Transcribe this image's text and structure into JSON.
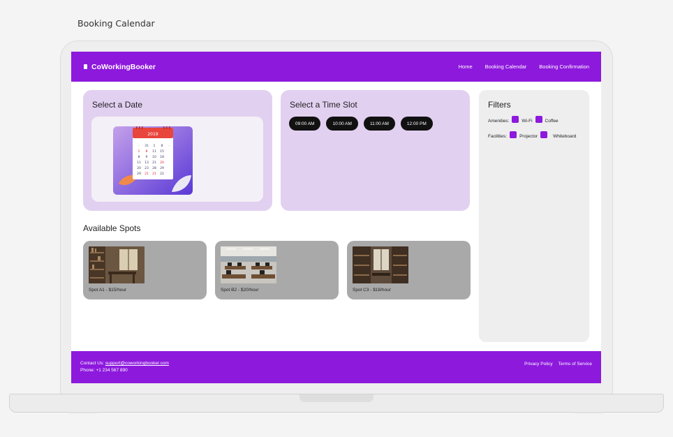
{
  "page_caption": "Booking Calendar",
  "brand": {
    "name": "CoWorkingBooker",
    "icon": "building-icon"
  },
  "nav": {
    "items": [
      "Home",
      "Booking Calendar",
      "Booking Confirmation"
    ]
  },
  "date_card": {
    "title": "Select a Date",
    "illustration": "calendar-icon",
    "calendar_year": "2019"
  },
  "time_card": {
    "title": "Select a Time Slot",
    "slots": [
      "09:00 AM",
      "10:00 AM",
      "11:00 AM",
      "12:00 PM"
    ]
  },
  "filters": {
    "title": "Filters",
    "amenities_label": "Amenities:",
    "amenities": [
      "Wi-Fi",
      "Coffee"
    ],
    "facilities_label": "Facilities:",
    "facilities": [
      "Projector",
      "Whiteboard"
    ]
  },
  "spots_section": {
    "title": "Available Spots",
    "spots": [
      {
        "label": "Spot A1 - $15/hour"
      },
      {
        "label": "Spot B2 - $20/hour"
      },
      {
        "label": "Spot C3 - $18/hour"
      }
    ]
  },
  "footer": {
    "contact_prefix": "Contact Us:",
    "email": "support@coworkingbooker.com",
    "phone": "Phone: +1 234 567 890",
    "links": [
      "Privacy Policy",
      "Terms of Service"
    ]
  },
  "colors": {
    "brand": "#8d19dd",
    "card": "#e2d0f1",
    "slot": "#111111",
    "spot_card": "#a9a9a9"
  }
}
